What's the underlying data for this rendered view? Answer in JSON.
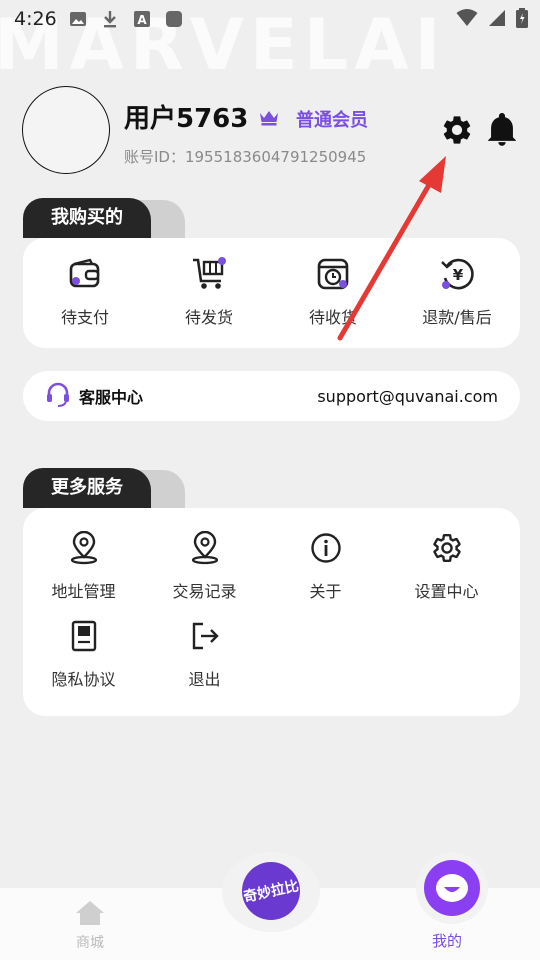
{
  "watermark": "MARVELAI",
  "status_bar": {
    "time": "4:26"
  },
  "profile": {
    "username": "用户5763",
    "member_level": "普通会员",
    "account_id": "账号ID：1955183604791250945"
  },
  "purchases": {
    "title": "我购买的",
    "items": [
      {
        "label": "待支付",
        "icon": "wallet-icon"
      },
      {
        "label": "待发货",
        "icon": "cart-icon"
      },
      {
        "label": "待收货",
        "icon": "package-clock-icon"
      },
      {
        "label": "退款/售后",
        "icon": "yen-refund-icon"
      }
    ]
  },
  "customer_service": {
    "label": "客服中心",
    "email": "support@quvanai.com"
  },
  "services": {
    "title": "更多服务",
    "items": [
      {
        "label": "地址管理",
        "icon": "location-pin-icon"
      },
      {
        "label": "交易记录",
        "icon": "location-pin-icon"
      },
      {
        "label": "关于",
        "icon": "info-icon"
      },
      {
        "label": "设置中心",
        "icon": "gear-icon"
      },
      {
        "label": "隐私协议",
        "icon": "document-icon"
      },
      {
        "label": "退出",
        "icon": "logout-icon"
      }
    ]
  },
  "bottom_nav": {
    "home_label": "商城",
    "center_logo_text": "奇妙拉比",
    "mine_label": "我的"
  },
  "colors": {
    "accent": "#7b4fe0",
    "arrow": "#e53935",
    "dark_tab": "#262626"
  }
}
